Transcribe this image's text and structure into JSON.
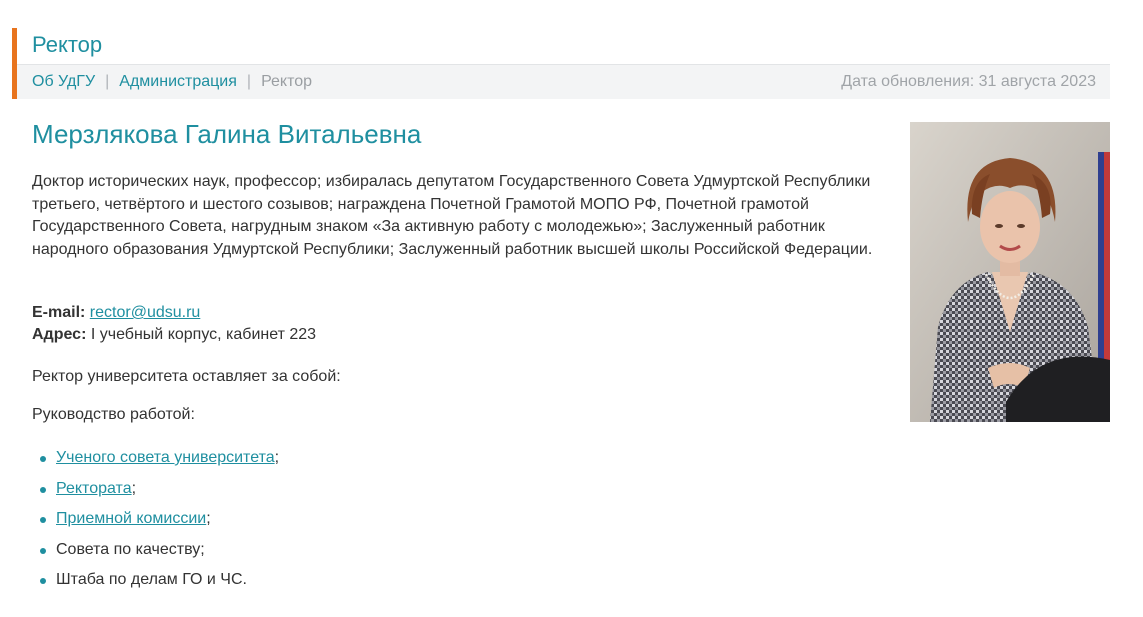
{
  "header": {
    "title": "Ректор",
    "breadcrumbs": [
      {
        "label": "Об УдГУ"
      },
      {
        "label": "Администрация"
      },
      {
        "label": "Ректор"
      }
    ],
    "updated": "Дата обновления: 31 августа 2023"
  },
  "person": {
    "name": "Мерзлякова Галина Витальевна",
    "bio": "Доктор исторических наук, профессор; избиралась депутатом Государственного Совета Удмуртской Республики третьего, четвёртого и шестого созывов; награждена Почетной Грамотой МОПО РФ, Почетной грамотой Государственного Совета, нагрудным знаком «За активную работу с молодежью»; Заслуженный работник народного образования Удмуртской Республики; Заслуженный работник высшей школы Российской Федерации.",
    "email_label": "E-mail:",
    "email": "rector@udsu.ru",
    "address_label": "Адрес:",
    "address": "I учебный корпус, кабинет 223"
  },
  "reserve_text": "Ректор университета оставляет за собой:",
  "lead_text": "Руководство работой:",
  "duties": [
    {
      "link": "Ученого совета университета",
      "suffix": ";"
    },
    {
      "link": "Ректората",
      "suffix": ";"
    },
    {
      "link": "Приемной комиссии",
      "suffix": ";"
    },
    {
      "text": "Совета по качеству;"
    },
    {
      "text": "Штаба по делам ГО и ЧС."
    }
  ],
  "colors": {
    "accent": "#1f8fa0",
    "header_bar": "#e8741e"
  }
}
